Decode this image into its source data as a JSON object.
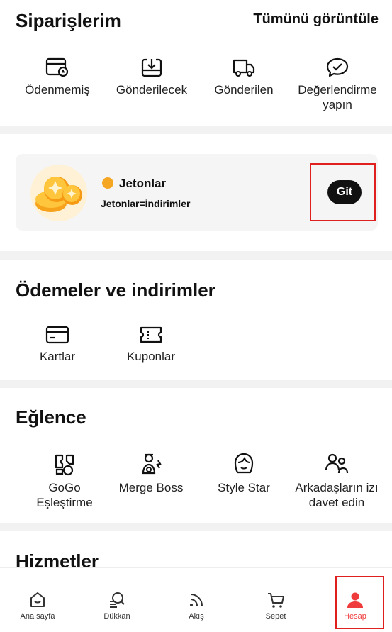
{
  "orders": {
    "title": "Siparişlerim",
    "view_all": "Tümünü görüntüle",
    "items": [
      {
        "label": "Ödenmemiş",
        "icon": "unpaid-icon"
      },
      {
        "label": "Gönderilecek",
        "icon": "to-ship-icon"
      },
      {
        "label": "Gönderilen",
        "icon": "shipped-truck-icon"
      },
      {
        "label": "Değerlendirme yapın",
        "icon": "review-chat-icon"
      }
    ]
  },
  "coins": {
    "title": "Jetonlar",
    "subtitle": "Jetonlar=İndirimler",
    "button": "Git"
  },
  "payments": {
    "title": "Ödemeler ve indirimler",
    "items": [
      {
        "label": "Kartlar",
        "icon": "card-icon"
      },
      {
        "label": "Kuponlar",
        "icon": "coupon-icon"
      }
    ]
  },
  "fun": {
    "title": "Eğlence",
    "items": [
      {
        "label": "GoGo Eşleştirme",
        "icon": "gogo-match-icon"
      },
      {
        "label": "Merge Boss",
        "icon": "merge-boss-icon"
      },
      {
        "label": "Style Star",
        "icon": "style-star-icon"
      },
      {
        "label": "Arkadaşların izı davet edin",
        "icon": "invite-friends-icon"
      }
    ]
  },
  "services": {
    "title": "Hizmetler"
  },
  "nav": {
    "items": [
      {
        "label": "Ana sayfa",
        "icon": "home-icon"
      },
      {
        "label": "Dükkan",
        "icon": "shop-icon"
      },
      {
        "label": "Akış",
        "icon": "feed-icon"
      },
      {
        "label": "Sepet",
        "icon": "cart-icon"
      },
      {
        "label": "Hesap",
        "icon": "account-icon"
      }
    ],
    "active_color": "#ef3b3b"
  }
}
